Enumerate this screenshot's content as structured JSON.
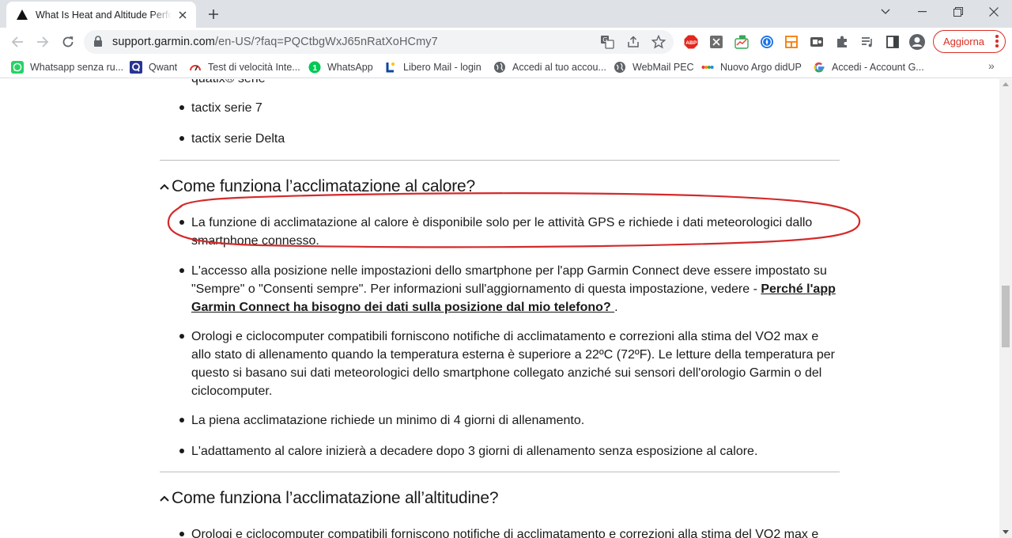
{
  "browser": {
    "tab": {
      "title": "What Is Heat and Altitude Performance Acclimation?",
      "favicon": "garmin-triangle-icon"
    },
    "url": {
      "host": "support.garmin.com",
      "path": "/en-US/?faq=PQCtbgWxJ65nRatXoHCmy7"
    },
    "update_button": "Aggiorna",
    "extension_badge": "ABP"
  },
  "bookmarks": [
    {
      "label": "Whatsapp senza ru...",
      "icon": "whatsapp-icon"
    },
    {
      "label": "Qwant",
      "icon": "qwant-icon"
    },
    {
      "label": "Test di velocità Inte...",
      "icon": "speedtest-icon"
    },
    {
      "label": "WhatsApp",
      "icon": "whatsapp-green-icon"
    },
    {
      "label": "Libero Mail - login",
      "icon": "libero-icon"
    },
    {
      "label": "Accedi al tuo accou...",
      "icon": "globe-icon"
    },
    {
      "label": "WebMail PEC",
      "icon": "globe-icon"
    },
    {
      "label": "Nuovo Argo didUP",
      "icon": "argo-icon"
    },
    {
      "label": "Accedi - Account G...",
      "icon": "google-icon"
    }
  ],
  "article": {
    "top_partial": "quatix® serie",
    "top_items": [
      "tactix serie 7",
      "tactix serie Delta"
    ],
    "section1": {
      "title": "Come funziona l’acclimatazione al calore?",
      "items": [
        {
          "text_lines": [
            "La funzione di acclimatazione al calore è disponibile solo per le attività GPS e richiede i dati meteorologici dallo",
            "smartphone connesso."
          ]
        },
        {
          "text_lines": [
            "L'accesso alla posizione nelle impostazioni dello smartphone per l'app Garmin Connect deve essere impostato su",
            "\"Sempre\" o \"Consenti sempre\". Per informazioni sull'aggiornamento di questa impostazione, vedere - "
          ],
          "link_part1": "Perché l'app",
          "link_part2": "Garmin Connect ha bisogno dei dati sulla posizione dal mio telefono? ",
          "after_link": "."
        },
        {
          "text_lines": [
            "Orologi e ciclocomputer compatibili forniscono notifiche di acclimatamento e correzioni alla stima del VO2 max e",
            "allo stato di allenamento quando la temperatura esterna è superiore a 22ºC (72ºF). Le letture della temperatura per",
            "questo si basano sui dati meteorologici dello smartphone collegato anziché sui sensori dell'orologio Garmin o del",
            "ciclocomputer."
          ]
        },
        {
          "text_lines": [
            "La piena acclimatazione richiede un minimo di 4 giorni di allenamento."
          ]
        },
        {
          "text_lines": [
            "L'adattamento al calore inizierà a decadere dopo 3 giorni di allenamento senza esposizione al calore."
          ]
        }
      ]
    },
    "section2": {
      "title": "Come funziona l’acclimatazione all’altitudine?",
      "first_item_partial": "Orologi e ciclocomputer compatibili forniscono notifiche di acclimatamento e correzioni alla stima del VO2 max e"
    }
  },
  "colors": {
    "annotation": "#d42a2a",
    "update_accent": "#d93025"
  }
}
